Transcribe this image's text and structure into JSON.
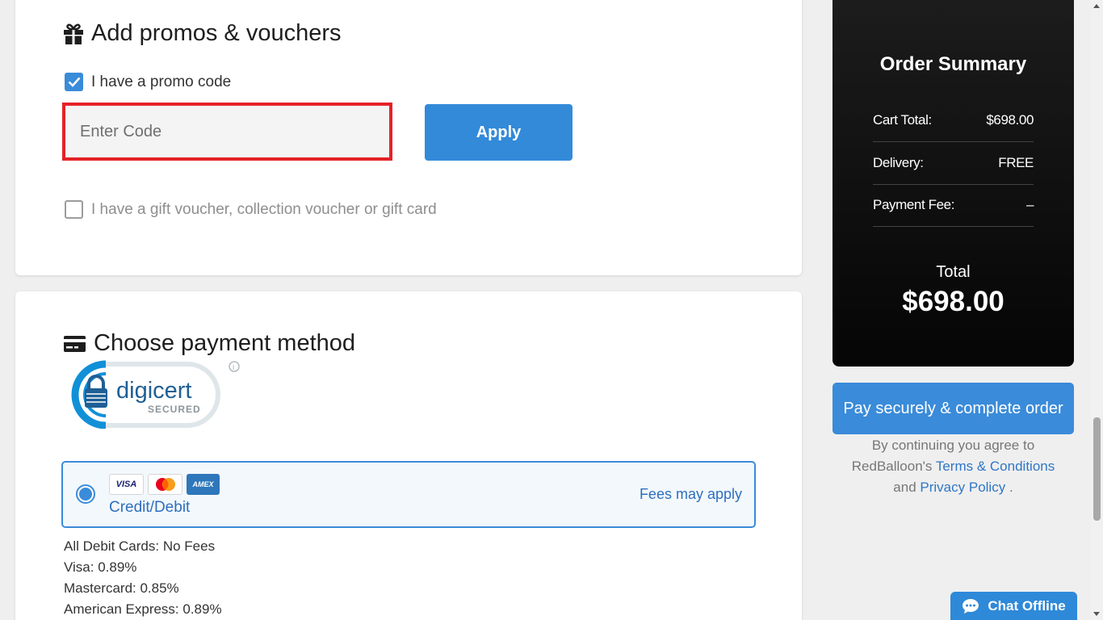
{
  "promos": {
    "title": "Add promos & vouchers",
    "promo_checkbox_label": "I have a promo code",
    "promo_checked": true,
    "code_placeholder": "Enter Code",
    "code_value": "",
    "apply_label": "Apply",
    "gift_checkbox_label": "I have a gift voucher, collection voucher or gift card",
    "gift_checked": false
  },
  "payment": {
    "title": "Choose payment method",
    "seal": {
      "brand": "digicert",
      "secured": "SECURED",
      "info_glyph": "i"
    },
    "method": {
      "label": "Credit/Debit",
      "fees_note": "Fees may apply",
      "logos": {
        "visa": "VISA",
        "amex": "AMEX"
      },
      "selected": true
    },
    "fees": [
      "All Debit Cards: No Fees",
      "Visa: 0.89%",
      "Mastercard: 0.85%",
      "American Express: 0.89%"
    ]
  },
  "summary": {
    "title": "Order Summary",
    "rows": [
      {
        "label": "Cart Total:",
        "value": "$698.00"
      },
      {
        "label": "Delivery:",
        "value": "FREE"
      },
      {
        "label": "Payment Fee:",
        "value": "–"
      }
    ],
    "total_label": "Total",
    "total_value": "$698.00"
  },
  "checkout": {
    "pay_label": "Pay securely & complete order",
    "agree_prefix": "By continuing you agree to RedBalloon's",
    "terms_link": "Terms & Conditions",
    "and_text": "and",
    "privacy_link": "Privacy Policy",
    "suffix": "."
  },
  "chat": {
    "label": "Chat Offline"
  },
  "colors": {
    "accent": "#3a8bd9",
    "error_border": "#e52228",
    "summary_bg": "#111111"
  }
}
